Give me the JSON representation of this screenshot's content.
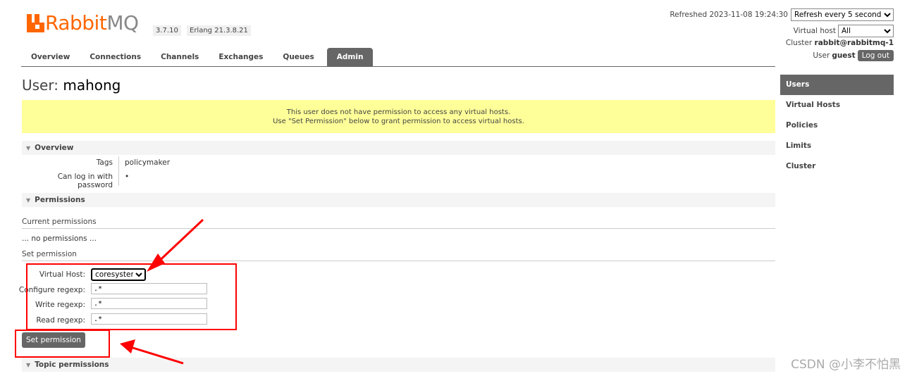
{
  "header": {
    "logo_rabbit": "Rabbit",
    "logo_mq": "MQ",
    "version": "3.7.10",
    "erlang": "Erlang 21.3.8.21",
    "refreshed_label": "Refreshed 2023-11-08 19:24:30",
    "refresh_select": "Refresh every 5 seconds",
    "vhost_label": "Virtual host",
    "vhost_select": "All",
    "cluster_label": "Cluster",
    "cluster_name": "rabbit@rabbitmq-1",
    "user_label": "User",
    "user_name": "guest",
    "logout": "Log out"
  },
  "nav": {
    "tabs": [
      "Overview",
      "Connections",
      "Channels",
      "Exchanges",
      "Queues",
      "Admin"
    ],
    "active": "Admin"
  },
  "rmenu": [
    "Users",
    "Virtual Hosts",
    "Policies",
    "Limits",
    "Cluster"
  ],
  "page": {
    "title_prefix": "User:",
    "title_name": "mahong",
    "warning_line1": "This user does not have permission to access any virtual hosts.",
    "warning_line2": "Use \"Set Permission\" below to grant permission to access virtual hosts."
  },
  "overview": {
    "header": "Overview",
    "tags_label": "Tags",
    "tags_value": "policymaker",
    "login_label": "Can log in with password",
    "login_value": "•"
  },
  "permissions": {
    "header": "Permissions",
    "current_label": "Current permissions",
    "none_text": "... no permissions ...",
    "set_label": "Set permission",
    "vhost_label": "Virtual Host:",
    "vhost_value": "coresystem",
    "configure_label": "Configure regexp:",
    "configure_value": ".*",
    "write_label": "Write regexp:",
    "write_value": ".*",
    "read_label": "Read regexp:",
    "read_value": ".*",
    "button": "Set permission"
  },
  "topic": {
    "header": "Topic permissions"
  },
  "watermark": "CSDN @小李不怕黑",
  "colors": {
    "brand": "#ff6600",
    "annotation": "#ff0000",
    "warning_bg": "#ffff99"
  }
}
